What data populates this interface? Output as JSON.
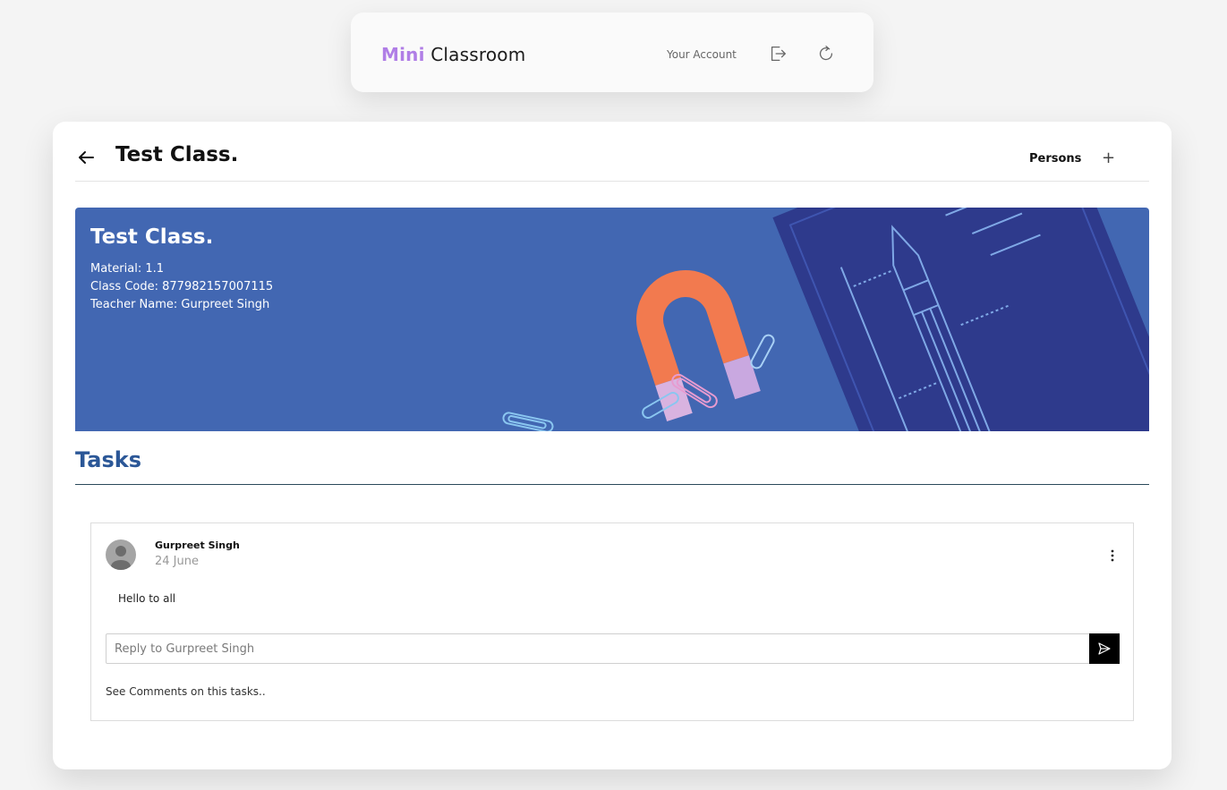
{
  "topbar": {
    "brand_mini": "Mini",
    "brand_rest": "Classroom",
    "account_label": "Your Account",
    "icons": [
      "logout-icon",
      "refresh-icon"
    ]
  },
  "header": {
    "title": "Test Class.",
    "persons_label": "Persons",
    "add_label": "+"
  },
  "banner": {
    "title": "Test Class.",
    "material": "Material: 1.1",
    "class_code": "Class Code: 877982157007115",
    "teacher": "Teacher Name: Gurpreet Singh"
  },
  "tasks": {
    "heading": "Tasks",
    "posts": [
      {
        "author": "Gurpreet Singh",
        "date": "24 June",
        "message": "Hello to all",
        "reply_placeholder": "Reply to Gurpreet Singh",
        "comments_link": "See Comments on this tasks.."
      }
    ]
  },
  "colors": {
    "brand_accent": "#b07ee6",
    "banner_bg": "#4267b2",
    "tasks_heading": "#2b5797",
    "send_button": "#000000"
  }
}
